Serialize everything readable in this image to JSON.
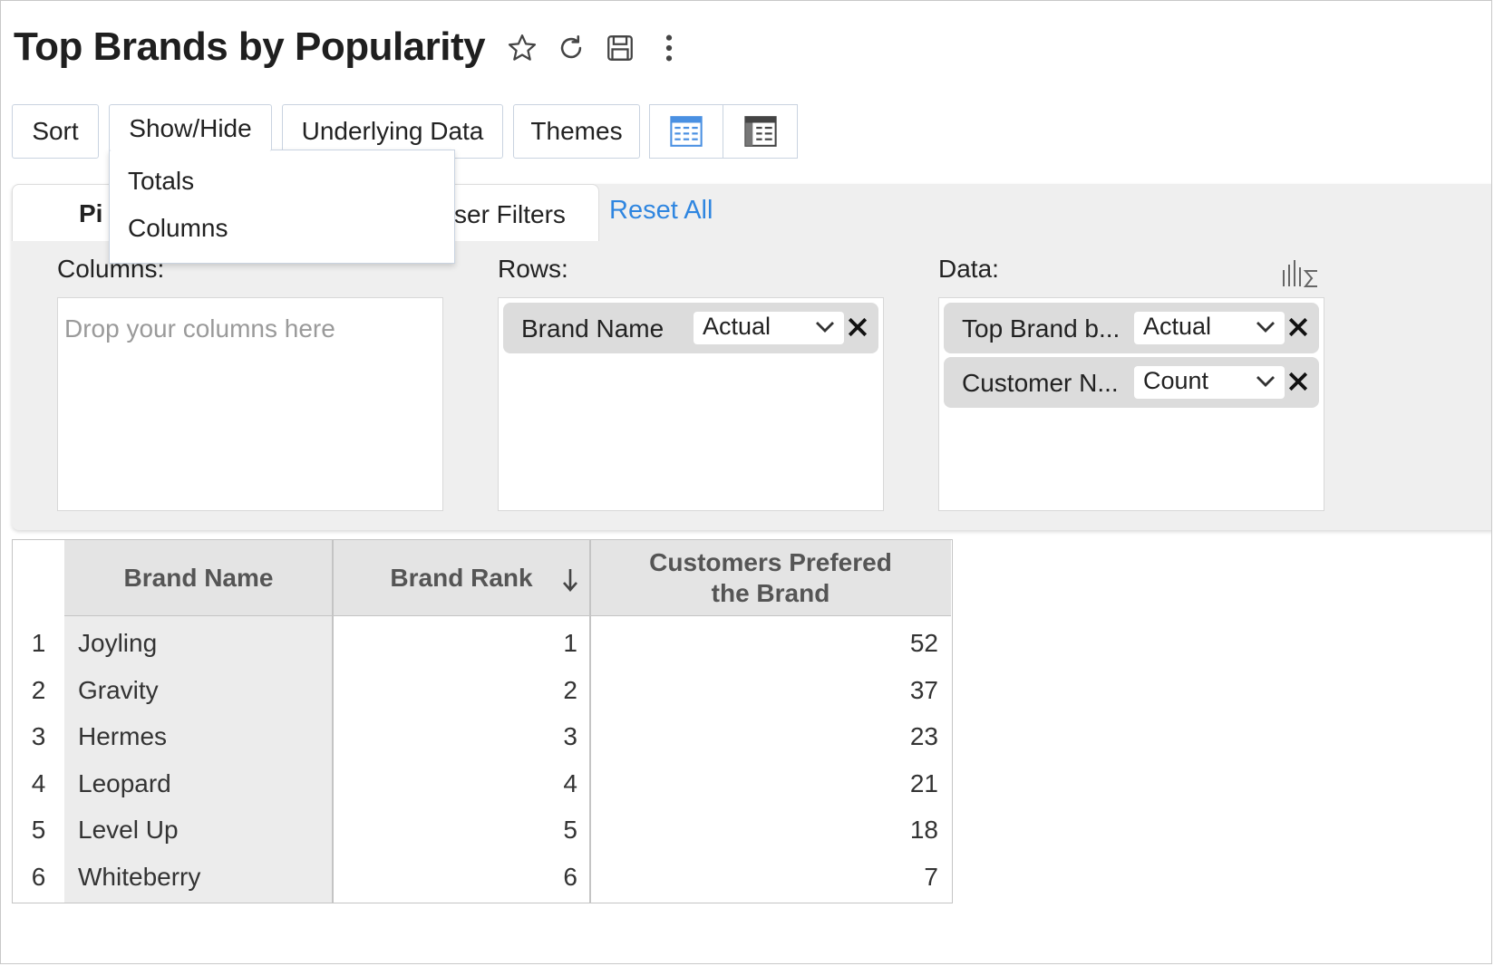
{
  "header": {
    "title": "Top Brands by Popularity",
    "icons": [
      "star-icon",
      "refresh-icon",
      "save-icon",
      "more-vertical-icon"
    ]
  },
  "toolbar": {
    "sort": "Sort",
    "show_hide": "Show/Hide",
    "underlying_data": "Underlying Data",
    "themes": "Themes",
    "view_icons": [
      "pivot-view-icon",
      "table-view-icon"
    ]
  },
  "show_hide_menu": {
    "items": [
      "Totals",
      "Columns"
    ]
  },
  "panel": {
    "tab_pivot_visible": "Pi",
    "tab_filters_visible": "ser Filters",
    "reset_all": "Reset All",
    "columns_label": "Columns:",
    "columns_placeholder": "Drop your columns here",
    "rows_label": "Rows:",
    "data_label": "Data:",
    "rows": [
      {
        "name": "Brand Name",
        "agg": "Actual"
      }
    ],
    "data": [
      {
        "name": "Top Brand b...",
        "agg": "Actual"
      },
      {
        "name": "Customer N...",
        "agg": "Count"
      }
    ]
  },
  "table": {
    "headers": {
      "brand_name": "Brand Name",
      "brand_rank": "Brand Rank",
      "customers_line1": "Customers Prefered",
      "customers_line2": "the Brand"
    },
    "rows": [
      {
        "n": "1",
        "brand": "Joyling",
        "rank": "1",
        "customers": "52"
      },
      {
        "n": "2",
        "brand": "Gravity",
        "rank": "2",
        "customers": "37"
      },
      {
        "n": "3",
        "brand": "Hermes",
        "rank": "3",
        "customers": "23"
      },
      {
        "n": "4",
        "brand": "Leopard",
        "rank": "4",
        "customers": "21"
      },
      {
        "n": "5",
        "brand": "Level Up",
        "rank": "5",
        "customers": "18"
      },
      {
        "n": "6",
        "brand": "Whiteberry",
        "rank": "6",
        "customers": "7"
      }
    ],
    "sort_indicator": "descending-arrow-icon"
  },
  "colors": {
    "accent": "#2f86e0",
    "panel_bg": "#efefef",
    "header_bg": "#e4e4e4",
    "toolbar_border": "#c9d3e0"
  }
}
